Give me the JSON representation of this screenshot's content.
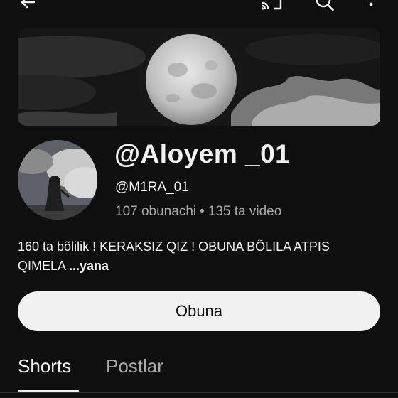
{
  "topbar": {
    "back_icon": "arrow-left-icon",
    "cast_icon": "cast-icon",
    "search_icon": "search-icon",
    "more_icon": "more-vert-icon"
  },
  "banner": {
    "image": "full-moon-night-clouds"
  },
  "channel": {
    "name": "@Aloyem _01",
    "handle": "@M1RA_01",
    "subscribers": "107 obunachi",
    "separator": "•",
    "videos": "135 ta video"
  },
  "description": {
    "text": "160 ta bõlilik ! KERAKSIZ QIZ ! OBUNA BÕLILA ATPIS QIMELA ",
    "more_label": "...yana"
  },
  "subscribe_button": {
    "label": "Obuna"
  },
  "tabs": [
    {
      "label": "Shorts",
      "active": true
    },
    {
      "label": "Postlar",
      "active": false
    }
  ],
  "colors": {
    "background": "#0f0f0f",
    "text": "#f1f1f1",
    "secondary_text": "#aaaaaa",
    "button_bg": "#f1f1f1"
  }
}
